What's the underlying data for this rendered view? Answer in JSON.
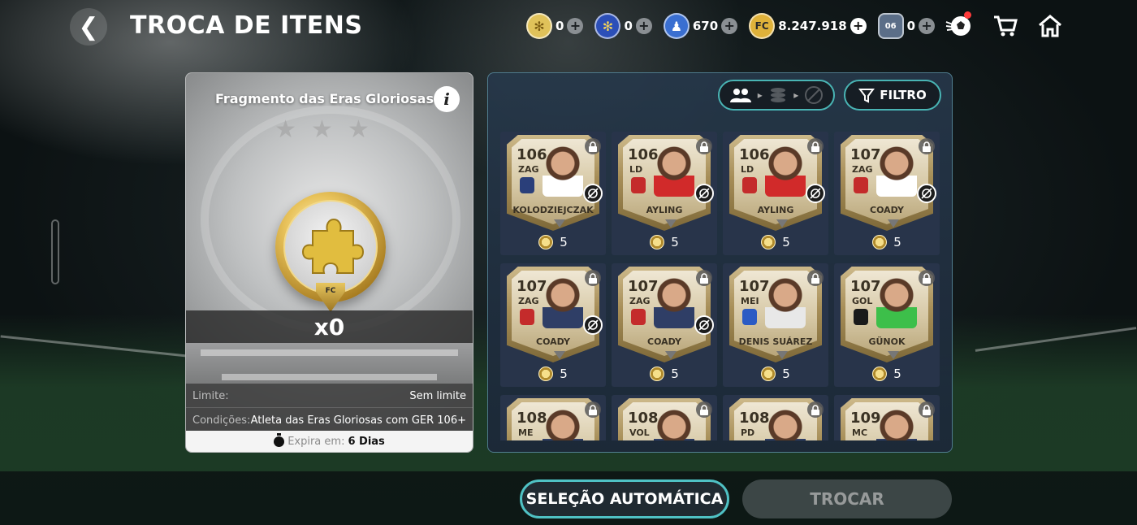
{
  "header": {
    "title": "TROCA DE ITENS",
    "currencies": [
      {
        "icon": "puzzle-gold-icon",
        "value": "0",
        "color": "#e0c25a"
      },
      {
        "icon": "puzzle-blue-icon",
        "value": "0",
        "color": "#2c4fb8"
      },
      {
        "icon": "player-token-icon",
        "value": "670",
        "color": "#3a6fd1"
      },
      {
        "icon": "fc-coin-icon",
        "value": "8.247.918",
        "color": "#e0b23a"
      },
      {
        "icon": "ovr-token-icon",
        "value": "0",
        "color": "#5b6e88"
      }
    ]
  },
  "item": {
    "title": "Fragmento das Eras Gloriosas",
    "quantity": "x0",
    "medal_badge": "FC",
    "limit_label": "Limite:",
    "limit_value": "Sem limite",
    "conditions_label": "Condições:",
    "conditions_value": "Atleta das Eras Gloriosas com GER 106+",
    "expires_label": "Expira em:",
    "expires_value": "6 Dias"
  },
  "filters": {
    "filter_label": "FILTRO"
  },
  "players": [
    {
      "rating": "106",
      "position": "ZAG",
      "name": "KOLODZIEJCZAK",
      "cost": "5",
      "club_color": "#2a3f7a",
      "shirt": "#ffffff",
      "untradeable": true
    },
    {
      "rating": "106",
      "position": "LD",
      "name": "AYLING",
      "cost": "5",
      "club_color": "#c42b2b",
      "shirt": "#d12a2a",
      "untradeable": true
    },
    {
      "rating": "106",
      "position": "LD",
      "name": "AYLING",
      "cost": "5",
      "club_color": "#c42b2b",
      "shirt": "#d12a2a",
      "untradeable": true
    },
    {
      "rating": "107",
      "position": "ZAG",
      "name": "COADY",
      "cost": "5",
      "club_color": "#c42b2b",
      "shirt": "#ffffff",
      "untradeable": true
    },
    {
      "rating": "107",
      "position": "ZAG",
      "name": "COADY",
      "cost": "5",
      "club_color": "#c42b2b",
      "shirt": "#2f3e66",
      "untradeable": true
    },
    {
      "rating": "107",
      "position": "ZAG",
      "name": "COADY",
      "cost": "5",
      "club_color": "#c42b2b",
      "shirt": "#2f3e66",
      "untradeable": true
    },
    {
      "rating": "107",
      "position": "MEI",
      "name": "DENIS SUÁREZ",
      "cost": "5",
      "club_color": "#2b5bc4",
      "shirt": "#e8e8e8",
      "untradeable": false
    },
    {
      "rating": "107",
      "position": "GOL",
      "name": "GÜNOK",
      "cost": "5",
      "club_color": "#1a1a1a",
      "shirt": "#3dbf4a",
      "untradeable": false
    },
    {
      "rating": "108",
      "position": "ME",
      "name": "",
      "cost": "",
      "club_color": "#888888",
      "shirt": "#2f3e66",
      "untradeable": false
    },
    {
      "rating": "108",
      "position": "VOL",
      "name": "",
      "cost": "",
      "club_color": "#888888",
      "shirt": "#2f3e66",
      "untradeable": false
    },
    {
      "rating": "108",
      "position": "PD",
      "name": "",
      "cost": "",
      "club_color": "#888888",
      "shirt": "#2f3e66",
      "untradeable": false
    },
    {
      "rating": "109",
      "position": "MC",
      "name": "",
      "cost": "",
      "club_color": "#888888",
      "shirt": "#2f3e66",
      "untradeable": false
    }
  ],
  "actions": {
    "auto_select": "SELEÇÃO AUTOMÁTICA",
    "trade": "TROCAR"
  }
}
